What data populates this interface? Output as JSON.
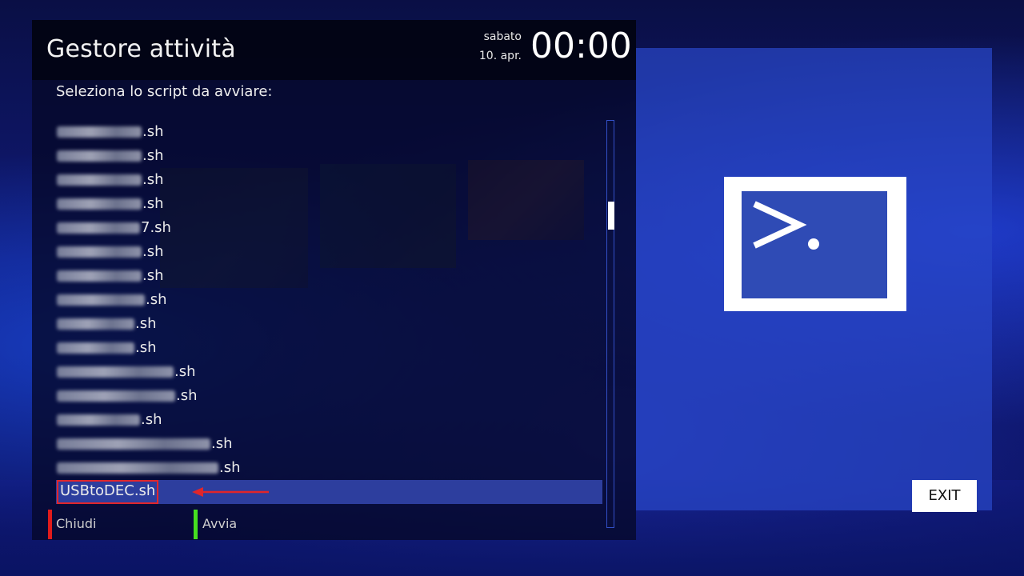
{
  "header": {
    "title": "Gestore attività",
    "day": "sabato",
    "date": "10. apr.",
    "time": "00:00"
  },
  "prompt": "Seleziona lo script da avviare:",
  "scripts": [
    {
      "suffix": ".sh",
      "blurred": true
    },
    {
      "suffix": ".sh",
      "blurred": true
    },
    {
      "suffix": ".sh",
      "blurred": true
    },
    {
      "suffix": ".sh",
      "blurred": true
    },
    {
      "suffix": "7.sh",
      "blurred": true
    },
    {
      "suffix": ".sh",
      "blurred": true
    },
    {
      "suffix": ".sh",
      "blurred": true
    },
    {
      "suffix": ".sh",
      "blurred": true
    },
    {
      "suffix": ".sh",
      "blurred": true
    },
    {
      "suffix": ".sh",
      "blurred": true
    },
    {
      "suffix": ".sh",
      "blurred": true
    },
    {
      "suffix": ".sh",
      "blurred": true
    },
    {
      "suffix": ".sh",
      "blurred": true
    },
    {
      "suffix": ".sh",
      "blurred": true
    },
    {
      "suffix": ".sh",
      "blurred": true
    }
  ],
  "selected_script": "USBtoDEC.sh",
  "buttons": {
    "red_label": "Chiudi",
    "green_label": "Avvia",
    "exit_label": "EXIT"
  },
  "colors": {
    "red_key": "#e01b1b",
    "green_key": "#46e020",
    "selection": "#2d3e9e",
    "highlight_box": "#e0262b"
  },
  "icons": {
    "preview": "terminal-icon"
  }
}
